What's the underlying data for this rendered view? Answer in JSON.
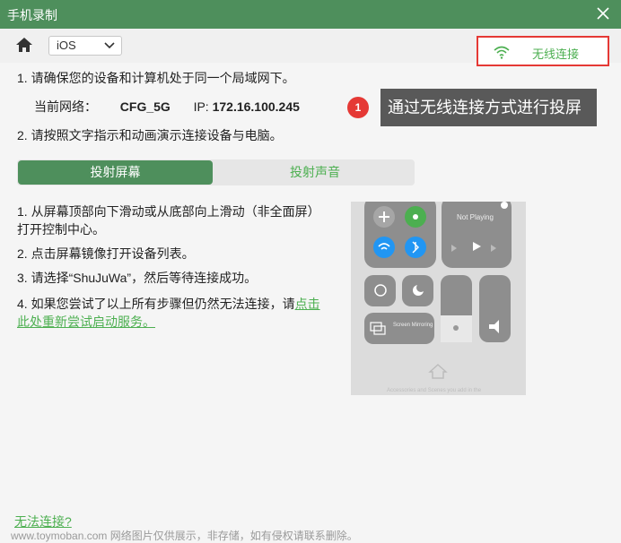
{
  "window": {
    "title": "手机录制"
  },
  "toolbar": {
    "os_select": "iOS",
    "wifi_label": "无线连接"
  },
  "steps": {
    "step1": "1. 请确保您的设备和计算机处于同一个局域网下。",
    "network_label": "当前网络：",
    "network_name": "CFG_5G",
    "ip_label": "IP:",
    "ip_value": "172.16.100.245",
    "step2": "2. 请按照文字指示和动画演示连接设备与电脑。"
  },
  "callout": {
    "number": "1",
    "text": "通过无线连接方式进行投屏"
  },
  "tabs": [
    {
      "label": "投射屏幕"
    },
    {
      "label": "投射声音"
    }
  ],
  "instructions": {
    "i1": "1. 从屏幕顶部向下滑动或从底部向上滑动（非全面屏）打开控制中心。",
    "i2": "2. 点击屏幕镜像打开设备列表。",
    "i3": "3. 请选择“ShuJuWa”，然后等待连接成功。",
    "i4_prefix": "4. 如果您尝试了以上所有步骤但仍然无法连接，请",
    "i4_link": "点击此处重新尝试启动服务。"
  },
  "control_center": {
    "now_playing": "Not Playing",
    "screen_mirroring": "Screen Mirroring",
    "bottom_text": "Accessories and Scenes you add in the"
  },
  "footer": {
    "cannot_connect": "无法连接?",
    "watermark": "www.toymoban.com 网络图片仅供展示，非存储，如有侵权请联系删除。"
  },
  "colors": {
    "titlebar": "#4e8f5c",
    "accent": "#4caf50",
    "highlight_border": "#e53935",
    "callout_bg": "#595959"
  }
}
